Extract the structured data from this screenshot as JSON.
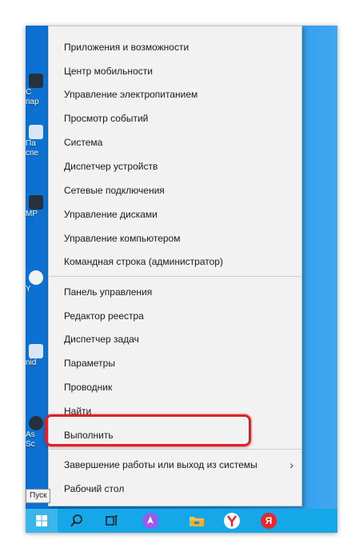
{
  "desktop": {
    "icon_fragments": [
      "С",
      "пар",
      "Па",
      "спе",
      "МР",
      "Y",
      "nid",
      "As",
      "Sc"
    ]
  },
  "menu": {
    "group1": [
      "Приложения и возможности",
      "Центр мобильности",
      "Управление электропитанием",
      "Просмотр событий",
      "Система",
      "Диспетчер устройств",
      "Сетевые подключения",
      "Управление дисками",
      "Управление компьютером",
      "Командная строка (администратор)"
    ],
    "group2": [
      "Панель управления",
      "Редактор реестра",
      "Диспетчер задач",
      "Параметры",
      "Проводник",
      "Найти",
      "Выполнить"
    ],
    "group3": [
      "Завершение работы или выход из системы",
      "Рабочий стол"
    ],
    "submenu_arrow": "›",
    "highlighted_item": "Выполнить",
    "highlight_color": "#e11f26"
  },
  "tooltip": {
    "text": "Пуск"
  },
  "taskbar": {
    "color": "#16a7e8",
    "icons": [
      "windows-start-icon",
      "search-icon",
      "task-view-icon",
      "alice-assistant-icon",
      "file-explorer-icon",
      "yandex-browser-icon",
      "yandex-icon"
    ],
    "yandex_label": "Я"
  }
}
